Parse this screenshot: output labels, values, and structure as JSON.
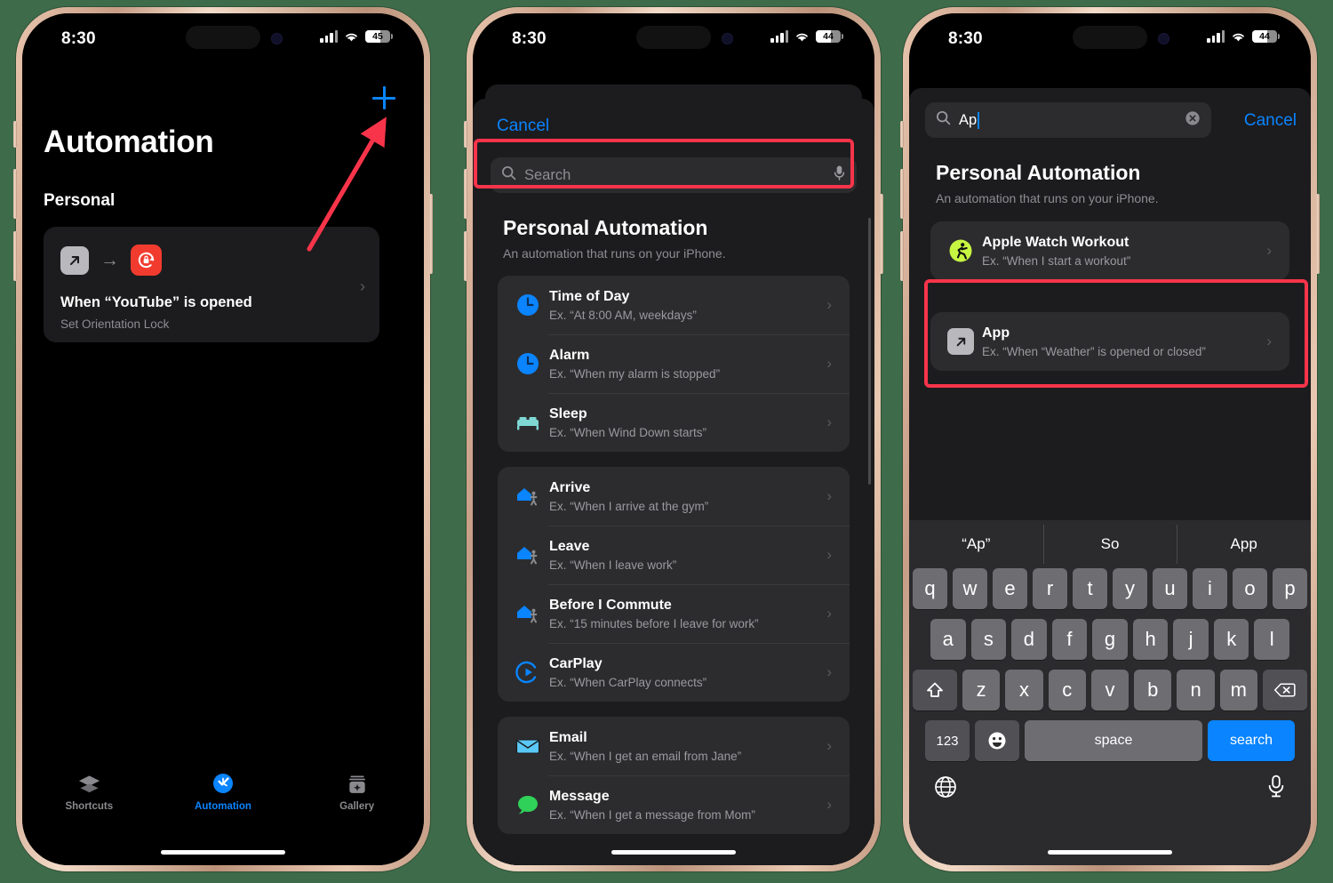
{
  "phones": [
    {
      "status": {
        "time": "8:30",
        "battery": "45",
        "battery_pct": 45
      },
      "screen": {
        "add_button_icon": "plus-icon",
        "title": "Automation",
        "section_label": "Personal",
        "automation_card": {
          "title": "When “YouTube” is opened",
          "subtitle": "Set Orientation Lock",
          "source_icon": "app-launch-icon",
          "arrow_icon": "arrow-right-icon",
          "action_icon": "orientation-lock-icon",
          "chevron_icon": "chevron-right-icon"
        },
        "tabs": [
          {
            "label": "Shortcuts",
            "icon": "layers-icon",
            "active": false
          },
          {
            "label": "Automation",
            "icon": "clock-check-icon",
            "active": true
          },
          {
            "label": "Gallery",
            "icon": "gallery-sparkle-icon",
            "active": false
          }
        ]
      }
    },
    {
      "status": {
        "time": "8:30",
        "battery": "44",
        "battery_pct": 44
      },
      "screen": {
        "cancel_label": "Cancel",
        "search": {
          "placeholder": "Search",
          "value": "",
          "icon": "search-icon",
          "mic_icon": "microphone-icon"
        },
        "header_title": "Personal Automation",
        "header_subtitle": "An automation that runs on your iPhone.",
        "groups": [
          {
            "rows": [
              {
                "title": "Time of Day",
                "subtitle": "Ex. “At 8:00 AM, weekdays”",
                "icon": "clock-icon",
                "icon_color": "#0a84ff"
              },
              {
                "title": "Alarm",
                "subtitle": "Ex. “When my alarm is stopped”",
                "icon": "alarm-clock-icon",
                "icon_color": "#0a84ff"
              },
              {
                "title": "Sleep",
                "subtitle": "Ex. “When Wind Down starts”",
                "icon": "bed-icon",
                "icon_color": "#7fd8d4"
              }
            ]
          },
          {
            "rows": [
              {
                "title": "Arrive",
                "subtitle": "Ex. “When I arrive at the gym”",
                "icon": "home-arrive-icon",
                "icon_color": "#0a84ff"
              },
              {
                "title": "Leave",
                "subtitle": "Ex. “When I leave work”",
                "icon": "home-leave-icon",
                "icon_color": "#0a84ff"
              },
              {
                "title": "Before I Commute",
                "subtitle": "Ex. “15 minutes before I leave for work”",
                "icon": "home-commute-icon",
                "icon_color": "#0a84ff"
              },
              {
                "title": "CarPlay",
                "subtitle": "Ex. “When CarPlay connects”",
                "icon": "carplay-icon",
                "icon_color": "#0a84ff"
              }
            ]
          },
          {
            "rows": [
              {
                "title": "Email",
                "subtitle": "Ex. “When I get an email from Jane”",
                "icon": "envelope-icon",
                "icon_color": "#5ac8f5"
              },
              {
                "title": "Message",
                "subtitle": "Ex. “When I get a message from Mom”",
                "icon": "message-bubble-icon",
                "icon_color": "#30d158"
              }
            ]
          }
        ]
      }
    },
    {
      "status": {
        "time": "8:30",
        "battery": "44",
        "battery_pct": 44
      },
      "screen": {
        "cancel_label": "Cancel",
        "search": {
          "value": "Ap",
          "icon": "search-icon",
          "clear_icon": "clear-circle-icon"
        },
        "header_title": "Personal Automation",
        "header_subtitle": "An automation that runs on your iPhone.",
        "results": [
          {
            "title": "Apple Watch Workout",
            "subtitle": "Ex. “When I start a workout”",
            "icon": "workout-runner-icon",
            "icon_color": "#c6f542",
            "highlighted": false
          },
          {
            "title": "App",
            "subtitle": "Ex. “When “Weather” is opened or closed”",
            "icon": "app-launch-icon",
            "icon_color": "#b9b9bd",
            "highlighted": true
          }
        ],
        "keyboard": {
          "predictions": [
            "“Ap”",
            "So",
            "App"
          ],
          "row1": [
            "q",
            "w",
            "e",
            "r",
            "t",
            "y",
            "u",
            "i",
            "o",
            "p"
          ],
          "row2": [
            "a",
            "s",
            "d",
            "f",
            "g",
            "h",
            "j",
            "k",
            "l"
          ],
          "row3": [
            "z",
            "x",
            "c",
            "v",
            "b",
            "n",
            "m"
          ],
          "shift_icon": "shift-up-icon",
          "backspace_icon": "backspace-icon",
          "numbers_label": "123",
          "emoji_icon": "emoji-smiley-icon",
          "space_label": "space",
          "return_label": "search",
          "globe_icon": "globe-icon",
          "dictation_icon": "microphone-icon"
        }
      }
    }
  ],
  "annotations": {
    "accent_color": "#f8344a",
    "arrow_icon": "pointer-arrow-icon",
    "highlight_targets": [
      "add-button",
      "search-field",
      "app-result-row"
    ]
  }
}
